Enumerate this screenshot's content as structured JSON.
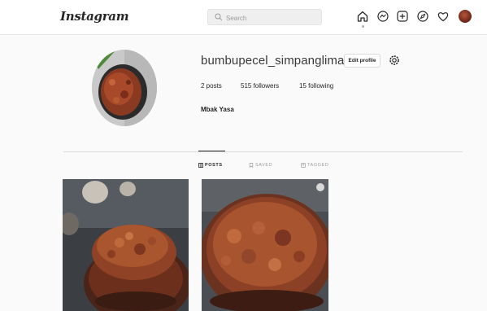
{
  "header": {
    "logo_text": "Instagram",
    "search_placeholder": "Search",
    "icons": [
      "home-icon",
      "direct-icon",
      "new-post-icon",
      "explore-icon",
      "activity-heart-icon",
      "avatar"
    ]
  },
  "profile": {
    "username": "bumbupecel_simpanglima",
    "edit_label": "Edit profile",
    "posts": "2 posts",
    "followers": "515 followers",
    "following": "15 following",
    "full_name": "Mbak Yasa"
  },
  "tabs": [
    {
      "label": "POSTS",
      "active": true
    },
    {
      "label": "SAVED",
      "active": false
    },
    {
      "label": "TAGGED",
      "active": false
    }
  ],
  "colors": {
    "accent_text": "#262626",
    "muted": "#8e8e8e",
    "border": "#dbdbdb"
  }
}
